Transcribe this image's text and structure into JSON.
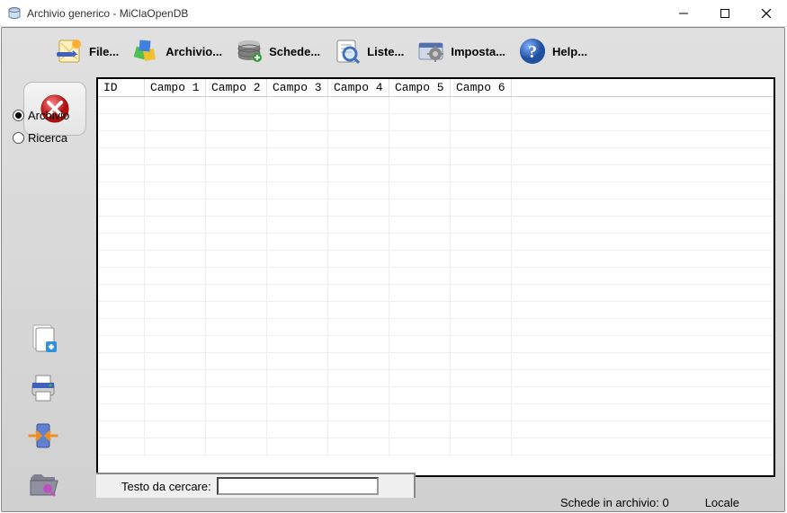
{
  "window": {
    "title": "Archivio generico - MiClaOpenDB"
  },
  "toolbar": {
    "file": "File...",
    "archivio": "Archivio...",
    "schede": "Schede...",
    "liste": "Liste...",
    "imposta": "Imposta...",
    "help": "Help..."
  },
  "sidebar": {
    "archivio_label": "Archivio",
    "ricerca_label": "Ricerca"
  },
  "grid": {
    "columns": [
      "ID",
      "Campo 1",
      "Campo 2",
      "Campo 3",
      "Campo 4",
      "Campo 5",
      "Campo 6"
    ]
  },
  "search": {
    "label": "Testo da cercare:",
    "value": ""
  },
  "status": {
    "schede_label": "Schede in archivio:",
    "schede_count": "0",
    "mode": "Locale"
  }
}
